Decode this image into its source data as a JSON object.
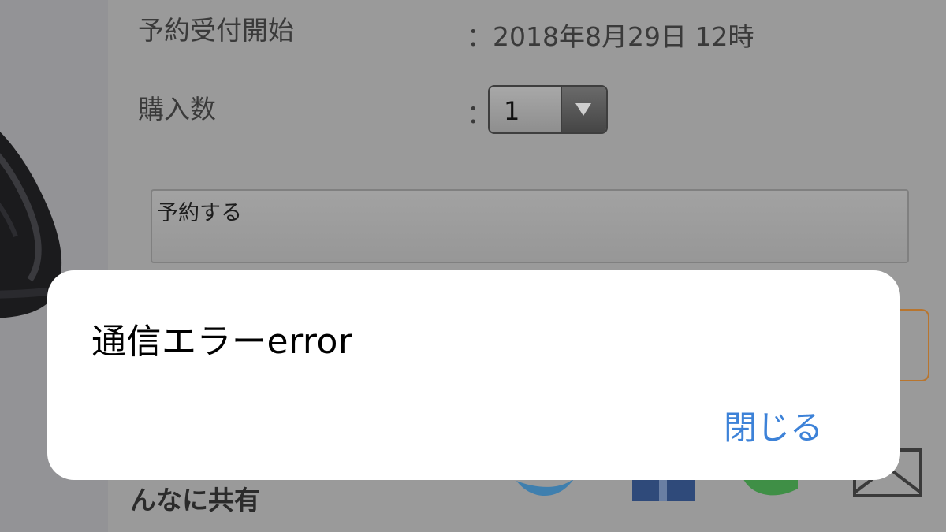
{
  "reservation": {
    "start_label": "予約受付開始",
    "start_colon": "：",
    "start_value": "2018年8月29日 12時",
    "quantity_label": "購入数",
    "quantity_colon": "：",
    "quantity_value": "1",
    "reserve_button_label": "予約する"
  },
  "share": {
    "label": "んなに共有",
    "icons": [
      "twitter-icon",
      "facebook-icon",
      "line-icon",
      "mail-icon"
    ]
  },
  "alert": {
    "message": "通信エラーerror",
    "close_label": "閉じる"
  },
  "colors": {
    "alert_button": "#3d82d8",
    "dim_background": "#9a9a9a",
    "accent_orange": "#b8752e",
    "twitter": "#3f7fae",
    "facebook": "#2f4a7a",
    "line": "#3f8f46"
  }
}
